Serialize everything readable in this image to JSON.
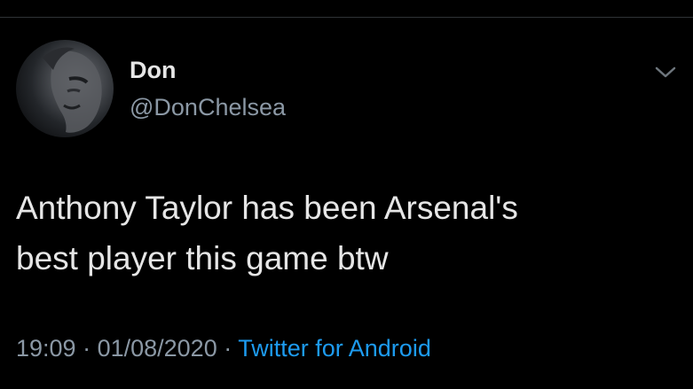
{
  "tweet": {
    "author": {
      "display_name": "Don",
      "handle": "@DonChelsea",
      "avatar_icon": "profile-photo"
    },
    "text_lines": [
      "Anthony Taylor has been Arsenal's",
      "best player this game btw"
    ],
    "time": "19:09",
    "separator": " · ",
    "date": "01/08/2020",
    "source": "Twitter for Android",
    "menu_icon": "chevron-down-icon"
  },
  "colors": {
    "background": "#000000",
    "primary_text": "#e6e6e6",
    "secondary_text": "#8b98a5",
    "link": "#1d9bf0",
    "divider": "#2f3336"
  }
}
